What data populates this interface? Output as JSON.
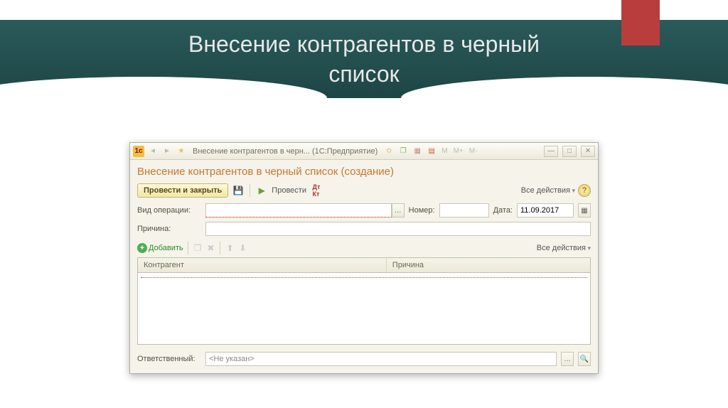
{
  "slide": {
    "title": "Внесение контрагентов в черный\nсписок"
  },
  "window": {
    "titlebar": {
      "title": "Внесение контрагентов в черн...  (1С:Предприятие)",
      "m_labels": [
        "M",
        "M+",
        "M-"
      ]
    },
    "form_title": "Внесение контрагентов в черный список (создание)",
    "toolbar": {
      "main_button": "Провести и закрыть",
      "apply_label": "Провести",
      "all_actions": "Все действия"
    },
    "fields": {
      "operation_label": "Вид операции:",
      "operation_value": "",
      "number_label": "Номер:",
      "number_value": "",
      "date_label": "Дата:",
      "date_value": "11.09.2017",
      "reason_label": "Причина:",
      "reason_value": ""
    },
    "sub_toolbar": {
      "add_label": "Добавить",
      "all_actions": "Все действия"
    },
    "grid": {
      "col1": "Контрагент",
      "col2": "Причина"
    },
    "footer": {
      "responsible_label": "Ответственный:",
      "responsible_value": "<Не указан>"
    }
  }
}
